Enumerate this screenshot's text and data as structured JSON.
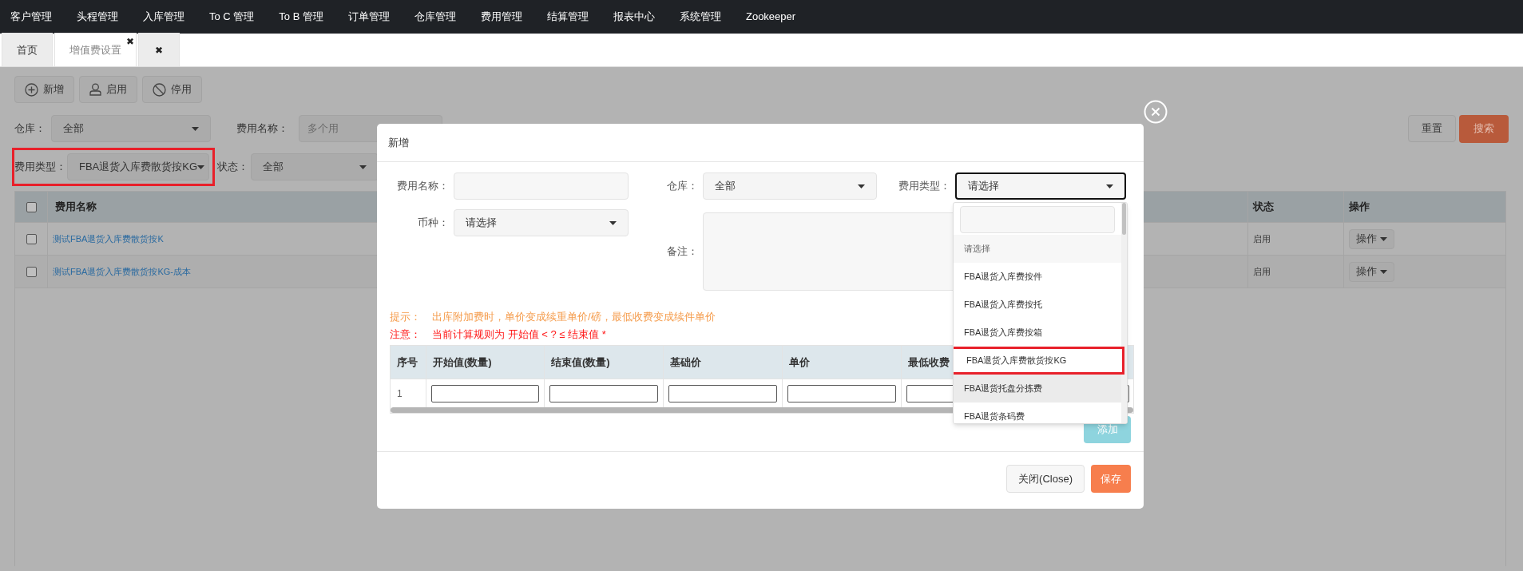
{
  "nav": [
    "客户管理",
    "头程管理",
    "入库管理",
    "To C 管理",
    "To B 管理",
    "订单管理",
    "仓库管理",
    "费用管理",
    "结算管理",
    "报表中心",
    "系统管理",
    "Zookeeper"
  ],
  "tabs": [
    {
      "label": "首页",
      "selected": false
    },
    {
      "label": "增值费设置",
      "selected": true,
      "close": "✖"
    },
    {
      "selected": false,
      "close": "✖"
    }
  ],
  "toolbar": [
    {
      "label": "新增"
    },
    {
      "label": "启用"
    },
    {
      "label": "停用"
    }
  ],
  "filters": [
    {
      "kind": "select",
      "label": "仓库：",
      "value": "全部",
      "highlighted": false
    },
    {
      "kind": "input",
      "label": "费用名称：",
      "placeholder": "多个用",
      "highlighted": false
    },
    {
      "kind": "select",
      "label": "费用类型：",
      "value": "FBA退货入库费散货按KG",
      "highlighted": true
    },
    {
      "kind": "select",
      "label": "状态：",
      "value": "全部",
      "highlighted": false
    }
  ],
  "reset_button": "重置",
  "search_button": "搜索",
  "table": {
    "all_checked": false,
    "columns": [
      "费用名称",
      "状态",
      "操作"
    ],
    "rows": [
      {
        "name": "测试FBA退货入库费散货按K",
        "status": "启用",
        "action": "操作",
        "checked": false
      },
      {
        "name": "测试FBA退货入库费散货按KG-成本",
        "status": "启用",
        "action": "操作",
        "checked": false
      }
    ]
  },
  "modal": {
    "title": "新增",
    "fields": [
      {
        "kind": "input",
        "label": "费用名称："
      },
      {
        "kind": "select",
        "label": "仓库：",
        "value": "全部",
        "focused": false
      },
      {
        "kind": "select",
        "label": "费用类型：",
        "value": "请选择",
        "focused": true
      },
      {
        "kind": "select",
        "label": "币种：",
        "value": "请选择",
        "focused": false
      },
      {
        "kind": "textarea",
        "label": "备注："
      }
    ],
    "tips": [
      {
        "kind": "hint",
        "label": "提示：",
        "text": "出库附加费时，单价变成续重单价/磅，最低收费变成续件单价"
      },
      {
        "kind": "warning",
        "label": "注意：",
        "text": "当前计算规则为 开始值 < ? ≤ 结束值 *"
      }
    ],
    "rule_table": {
      "columns": [
        "序号",
        "开始值(数量)",
        "结束值(数量)",
        "基础价",
        "单价",
        "最低收费"
      ],
      "rows": [
        {
          "index": "1"
        }
      ]
    },
    "add_button": "添加",
    "close_button": "关闭(Close)",
    "save_button": "保存",
    "dropdown": {
      "items": [
        {
          "label": "请选择",
          "selected": true,
          "hovered": false,
          "highlighted": false
        },
        {
          "label": "FBA退货入库费按件",
          "selected": false,
          "hovered": false,
          "highlighted": false
        },
        {
          "label": "FBA退货入库费按托",
          "selected": false,
          "hovered": false,
          "highlighted": false
        },
        {
          "label": "FBA退货入库费按箱",
          "selected": false,
          "hovered": false,
          "highlighted": false
        },
        {
          "label": "FBA退货入库费散货按KG",
          "selected": false,
          "hovered": false,
          "highlighted": true
        },
        {
          "label": "FBA退货托盘分拣费",
          "selected": false,
          "hovered": true,
          "highlighted": false
        },
        {
          "label": "FBA退货条码费",
          "selected": false,
          "hovered": false,
          "highlighted": false
        }
      ]
    }
  }
}
